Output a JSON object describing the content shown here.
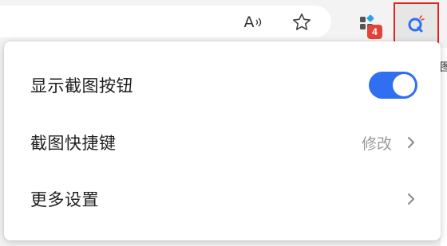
{
  "toolbar": {
    "read_aloud_glyph": "A",
    "extensions_badge": "4",
    "icons": [
      "read-aloud-icon",
      "favorite-star-icon",
      "extensions-icon",
      "screenshot-extension-icon"
    ]
  },
  "edge_glyph": "图",
  "popup": {
    "items": [
      {
        "label": "显示截图按钮",
        "control": "toggle",
        "toggle_on": true
      },
      {
        "label": "截图快捷键",
        "action_label": "修改",
        "control": "chevron"
      },
      {
        "label": "更多设置",
        "control": "chevron"
      }
    ]
  },
  "colors": {
    "toggle_on": "#2f6ff0",
    "badge": "#e0453a",
    "highlight_border": "#e02424",
    "muted_text": "#9a9a9a"
  }
}
